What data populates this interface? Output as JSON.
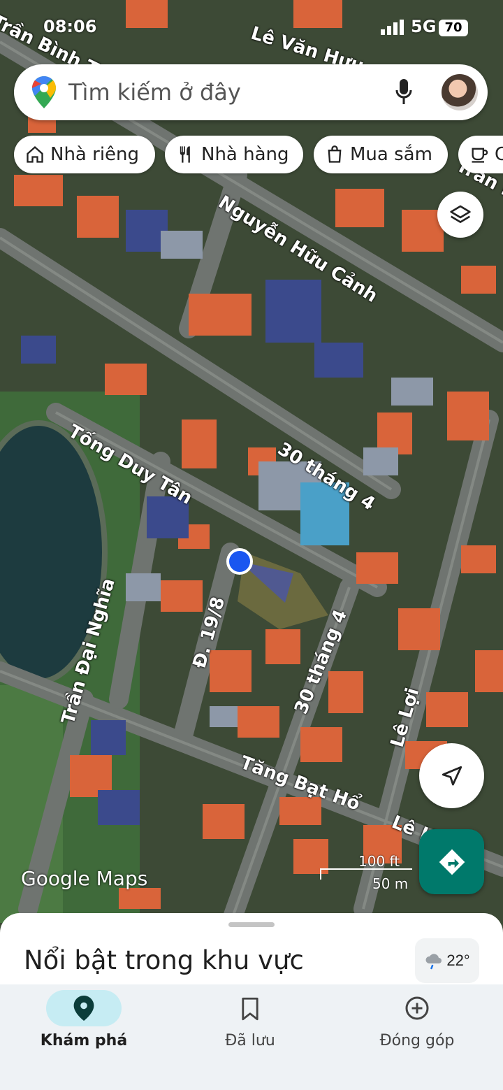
{
  "status_bar": {
    "time": "08:06",
    "network": "5G",
    "battery": "70"
  },
  "search": {
    "placeholder": "Tìm kiếm ở đây"
  },
  "chips": [
    {
      "label": "Nhà riêng",
      "icon": "home-icon"
    },
    {
      "label": "Nhà hàng",
      "icon": "restaurant-icon"
    },
    {
      "label": "Mua sắm",
      "icon": "shopping-bag-icon"
    },
    {
      "label": "C",
      "icon": "coffee-icon"
    }
  ],
  "streets": {
    "tran_binh_trong_top": "Trần Bình Trọng",
    "le_van_huu": "Lê Văn Hưu",
    "nguyen_huu_canh": "Nguyễn Hữu Cảnh",
    "tran_binh_right": "Trần Bình T",
    "tong_duy_tan": "Tống Duy Tân",
    "ba_thang_4_a": "30 tháng 4",
    "ba_thang_4_b": "30 tháng 4",
    "duong_19_8": "Đ. 19/8",
    "tran_dai_nghia": "Trần Đại Nghĩa",
    "le_loi": "Lê Lợi",
    "tang_bat_ho": "Tăng Bạt Hổ",
    "le_h": "Lê H"
  },
  "map": {
    "logo": "Google Maps",
    "scale_ft": "100 ft",
    "scale_m": "50 m"
  },
  "sheet": {
    "title": "Nổi bật trong khu vực"
  },
  "weather": {
    "temp": "22°"
  },
  "nav": {
    "explore": "Khám phá",
    "saved": "Đã lưu",
    "contribute": "Đóng góp"
  },
  "colors": {
    "accent": "#00796b",
    "pill": "#c6ecf3",
    "location": "#1a56f0"
  }
}
